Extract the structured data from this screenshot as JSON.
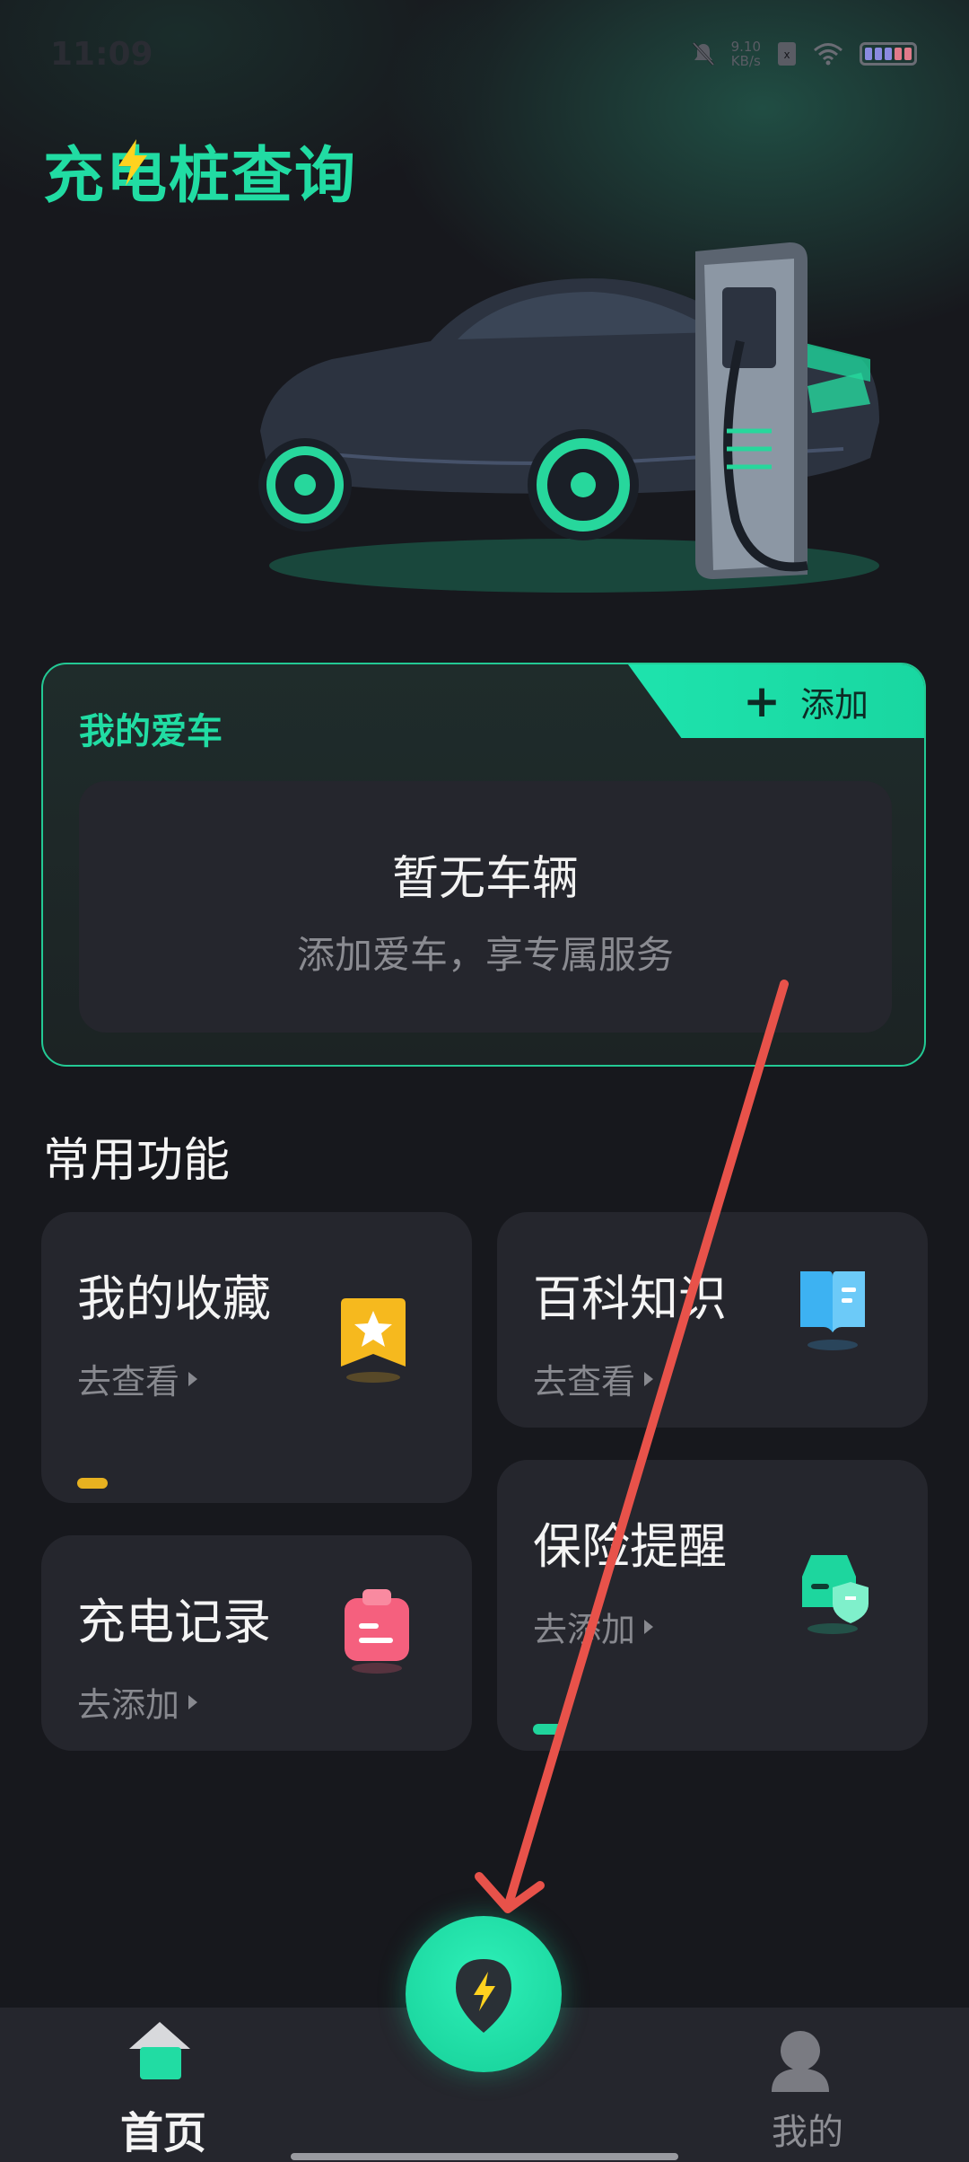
{
  "status_bar": {
    "time": "11:09",
    "net_speed": "9.10",
    "net_unit": "KB/s"
  },
  "app": {
    "title": "充电桩查询"
  },
  "car_card": {
    "title": "我的爱车",
    "add_label": "添加",
    "empty_title": "暂无车辆",
    "empty_subtitle": "添加爱车，享专属服务"
  },
  "features": {
    "section_title": "常用功能",
    "favorites": {
      "title": "我的收藏",
      "action": "去查看"
    },
    "encyclopedia": {
      "title": "百科知识",
      "action": "去查看"
    },
    "charge_records": {
      "title": "充电记录",
      "action": "去添加"
    },
    "insurance": {
      "title": "保险提醒",
      "action": "去添加"
    }
  },
  "bottom_nav": {
    "home_label": "首页",
    "mine_label": "我的"
  },
  "colors": {
    "accent": "#21dca3",
    "background": "#17181d",
    "card": "#25262d",
    "annotation_arrow": "#e8524a"
  },
  "icons": [
    "lightning-icon",
    "star-bookmark-icon",
    "book-icon",
    "clipboard-icon",
    "car-shield-icon",
    "home-icon",
    "user-icon",
    "charge-location-icon"
  ]
}
